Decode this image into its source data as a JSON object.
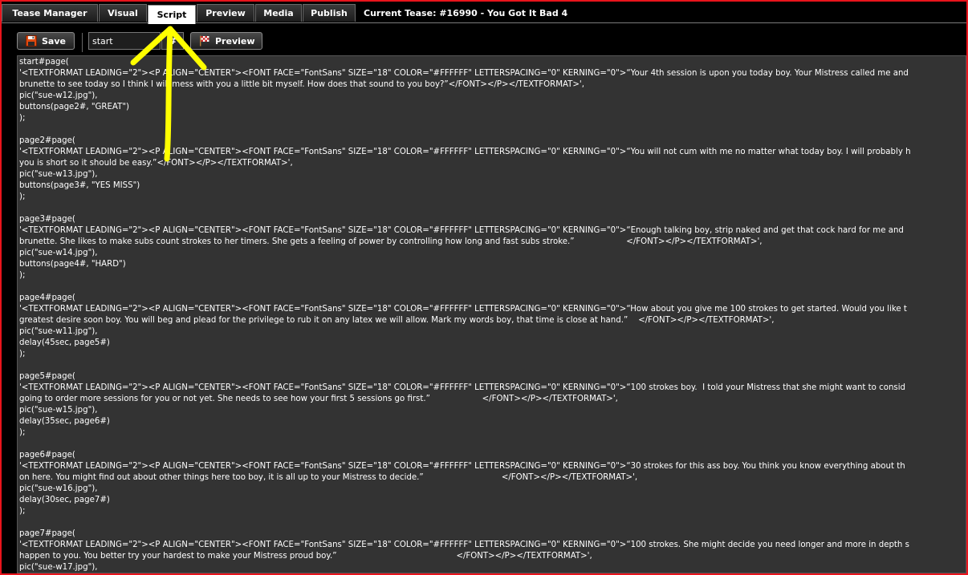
{
  "tabs": [
    {
      "label": "Tease Manager"
    },
    {
      "label": "Visual"
    },
    {
      "label": "Script"
    },
    {
      "label": "Preview"
    },
    {
      "label": "Media"
    },
    {
      "label": "Publish"
    }
  ],
  "active_tab": "Script",
  "current_tease": "Current Tease: #16990 - You Got It Bad 4",
  "toolbar": {
    "save_label": "Save",
    "page_input_value": "start",
    "hash_label": "#",
    "preview_label": "Preview"
  },
  "script_lines": [
    "start#page(",
    "'<TEXTFORMAT LEADING=\"2\"><P ALIGN=\"CENTER\"><FONT FACE=\"FontSans\" SIZE=\"18\" COLOR=\"#FFFFFF\" LETTERSPACING=\"0\" KERNING=\"0\">“Your 4th session is upon you today boy. Your Mistress called me and",
    "brunette to see today so I think I will mess with you a little bit myself. How does that sound to you boy?”</FONT></P></TEXTFORMAT>',",
    "pic(\"sue-w12.jpg\"),",
    "buttons(page2#, \"GREAT\")",
    ");",
    "",
    "page2#page(",
    "'<TEXTFORMAT LEADING=\"2\"><P ALIGN=\"CENTER\"><FONT FACE=\"FontSans\" SIZE=\"18\" COLOR=\"#FFFFFF\" LETTERSPACING=\"0\" KERNING=\"0\">“You will not cum with me no matter what today boy. I will probably h",
    "you is short so it should be easy.”</FONT></P></TEXTFORMAT>',",
    "pic(\"sue-w13.jpg\"),",
    "buttons(page3#, \"YES MISS\")",
    ");",
    "",
    "page3#page(",
    "'<TEXTFORMAT LEADING=\"2\"><P ALIGN=\"CENTER\"><FONT FACE=\"FontSans\" SIZE=\"18\" COLOR=\"#FFFFFF\" LETTERSPACING=\"0\" KERNING=\"0\">“Enough talking boy, strip naked and get that cock hard for me and",
    "brunette. She likes to make subs count strokes to her timers. She gets a feeling of power by controlling how long and fast subs stroke.”                    </FONT></P></TEXTFORMAT>',",
    "pic(\"sue-w14.jpg\"),",
    "buttons(page4#, \"HARD\")",
    ");",
    "",
    "page4#page(",
    "'<TEXTFORMAT LEADING=\"2\"><P ALIGN=\"CENTER\"><FONT FACE=\"FontSans\" SIZE=\"18\" COLOR=\"#FFFFFF\" LETTERSPACING=\"0\" KERNING=\"0\">“How about you give me 100 strokes to get started. Would you like t",
    "greatest desire soon boy. You will beg and plead for the privilege to rub it on any latex we will allow. Mark my words boy, that time is close at hand.”    </FONT></P></TEXTFORMAT>',",
    "pic(\"sue-w11.jpg\"),",
    "delay(45sec, page5#)",
    ");",
    "",
    "page5#page(",
    "'<TEXTFORMAT LEADING=\"2\"><P ALIGN=\"CENTER\"><FONT FACE=\"FontSans\" SIZE=\"18\" COLOR=\"#FFFFFF\" LETTERSPACING=\"0\" KERNING=\"0\">“100 strokes boy.  I told your Mistress that she might want to consid",
    "going to order more sessions for you or not yet. She needs to see how your first 5 sessions go first.”                    </FONT></P></TEXTFORMAT>',",
    "pic(\"sue-w15.jpg\"),",
    "delay(35sec, page6#)",
    ");",
    "",
    "page6#page(",
    "'<TEXTFORMAT LEADING=\"2\"><P ALIGN=\"CENTER\"><FONT FACE=\"FontSans\" SIZE=\"18\" COLOR=\"#FFFFFF\" LETTERSPACING=\"0\" KERNING=\"0\">“30 strokes for this ass boy. You think you know everything about th",
    "on here. You might find out about other things here too boy, it is all up to your Mistress to decide.”                              </FONT></P></TEXTFORMAT>',",
    "pic(\"sue-w16.jpg\"),",
    "delay(30sec, page7#)",
    ");",
    "",
    "page7#page(",
    "'<TEXTFORMAT LEADING=\"2\"><P ALIGN=\"CENTER\"><FONT FACE=\"FontSans\" SIZE=\"18\" COLOR=\"#FFFFFF\" LETTERSPACING=\"0\" KERNING=\"0\">“100 strokes. She might decide you need longer and more in depth s",
    "happen to you. You better try your hardest to make your Mistress proud boy.”                                              </FONT></P></TEXTFORMAT>',",
    "pic(\"sue-w17.jpg\"),"
  ],
  "colors": {
    "frame_border": "#e8141c",
    "annotation_arrow": "#ffff00",
    "editor_background": "#333333"
  }
}
